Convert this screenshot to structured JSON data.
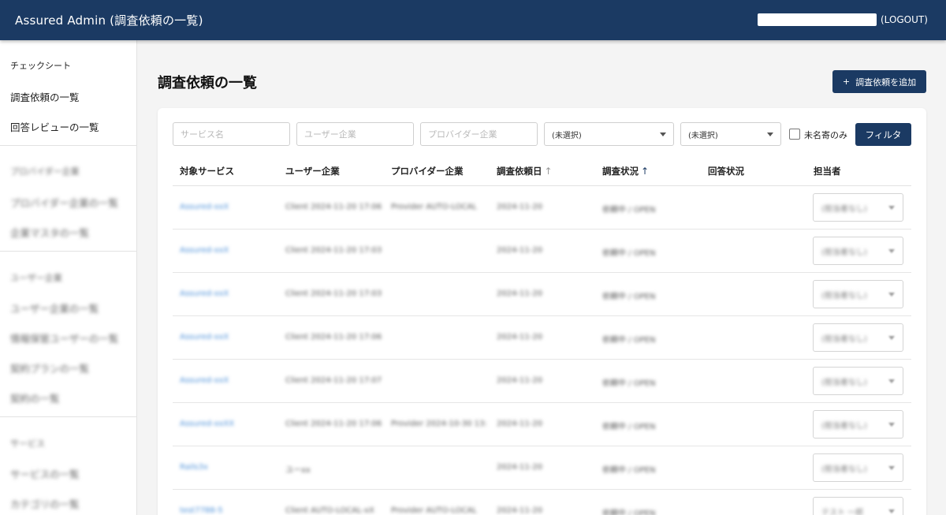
{
  "header": {
    "title": "Assured Admin (調査依頼の一覧)",
    "logout_label": "(LOGOUT)"
  },
  "sidebar": {
    "items": [
      {
        "label": "チェックシート",
        "blurred": false
      },
      {
        "label": "調査依頼の一覧",
        "blurred": false
      },
      {
        "label": "回答レビューの一覧",
        "blurred": false
      },
      {
        "label": "プロバイダー企業",
        "blurred": true
      },
      {
        "label": "プロバイダー企業の一覧",
        "blurred": true
      },
      {
        "label": "企業マスタの一覧",
        "blurred": true
      },
      {
        "label": "ユーザー企業",
        "blurred": true
      },
      {
        "label": "ユーザー企業の一覧",
        "blurred": true
      },
      {
        "label": "情報保管ユーザーの一覧",
        "blurred": true
      },
      {
        "label": "契約プランの一覧",
        "blurred": true
      },
      {
        "label": "契約の一覧",
        "blurred": true
      },
      {
        "label": "サービス",
        "blurred": true
      },
      {
        "label": "サービスの一覧",
        "blurred": true
      },
      {
        "label": "カテゴリの一覧",
        "blurred": true
      }
    ]
  },
  "main": {
    "title": "調査依頼の一覧",
    "add_button_label": "調査依頼を追加",
    "add_button_icon": "plus-icon"
  },
  "filters": {
    "service_placeholder": "サービス名",
    "user_company_placeholder": "ユーザー企業",
    "provider_company_placeholder": "プロバイダー企業",
    "select1_value": "(未選択)",
    "select2_value": "(未選択)",
    "unnamed_only_label": "未名寄のみ",
    "unnamed_only_checked": false,
    "filter_button_label": "フィルタ"
  },
  "table": {
    "columns": [
      "対象サービス",
      "ユーザー企業",
      "プロバイダー企業",
      "調査依頼日",
      "調査状況",
      "回答状況",
      "担当者"
    ],
    "sorted_columns": {
      "調査依頼日": "inactive",
      "調査状況": "active"
    },
    "rows": [
      {
        "service": "Assured-xxX",
        "user": "Client 2024-11-20 17:06",
        "provider": "Provider AUTO-LOCAL",
        "date": "2024-11-20",
        "status": "依頼中 / OPEN",
        "answer": "",
        "assignee": "(担当者なし)"
      },
      {
        "service": "Assured-xxX",
        "user": "Client 2024-11-20 17:03",
        "provider": "",
        "date": "2024-11-20",
        "status": "依頼中 / OPEN",
        "answer": "",
        "assignee": "(担当者なし)"
      },
      {
        "service": "Assured-xxX",
        "user": "Client 2024-11-20 17:03",
        "provider": "",
        "date": "2024-11-20",
        "status": "依頼中 / OPEN",
        "answer": "",
        "assignee": "(担当者なし)"
      },
      {
        "service": "Assured-xxX",
        "user": "Client 2024-11-20 17:06",
        "provider": "",
        "date": "2024-11-20",
        "status": "依頼中 / OPEN",
        "answer": "",
        "assignee": "(担当者なし)"
      },
      {
        "service": "Assured-xxX",
        "user": "Client 2024-11-20 17:07",
        "provider": "",
        "date": "2024-11-20",
        "status": "依頼中 / OPEN",
        "answer": "",
        "assignee": "(担当者なし)"
      },
      {
        "service": "Assured-xxXX",
        "user": "Client 2024-11-20 17:06",
        "provider": "Provider 2024-10-30 13:",
        "date": "2024-11-20",
        "status": "依頼中 / OPEN",
        "answer": "",
        "assignee": "(担当者なし)"
      },
      {
        "service": "Rails3x",
        "user": "ユーxx",
        "provider": "",
        "date": "2024-11-20",
        "status": "依頼中 / OPEN",
        "answer": "",
        "assignee": "(担当者なし)"
      },
      {
        "service": "test7788-5",
        "user": "Client AUTO-LOCAL-xX",
        "provider": "Provider AUTO-LOCAL",
        "date": "2024-11-20",
        "status": "依頼中 / OPEN",
        "answer": "",
        "assignee": "テスト 一郎"
      }
    ]
  }
}
